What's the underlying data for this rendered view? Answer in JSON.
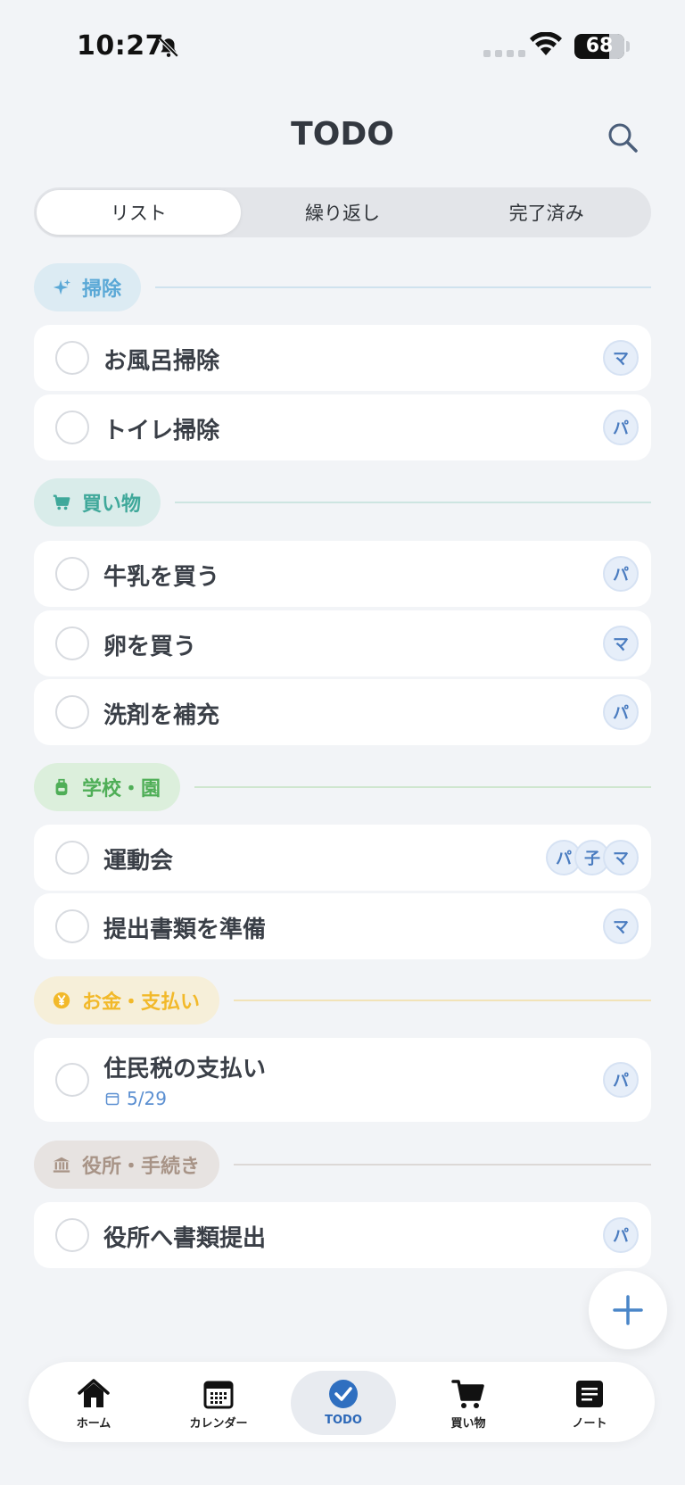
{
  "status_bar": {
    "time": "10:27",
    "battery": "68"
  },
  "header": {
    "title": "TODO"
  },
  "tabs": [
    {
      "label": "リスト",
      "active": true
    },
    {
      "label": "繰り返し",
      "active": false
    },
    {
      "label": "完了済み",
      "active": false
    }
  ],
  "sections": [
    {
      "name": "掃除",
      "icon": "sparkle-icon",
      "color": "#5aa8d6",
      "bg": "#dcebf3",
      "tasks": [
        {
          "title": "お風呂掃除",
          "assignees": [
            "マ"
          ]
        },
        {
          "title": "トイレ掃除",
          "assignees": [
            "パ"
          ]
        }
      ]
    },
    {
      "name": "買い物",
      "icon": "cart-icon",
      "color": "#3fa89a",
      "bg": "#d9ecea",
      "tasks": [
        {
          "title": "牛乳を買う",
          "assignees": [
            "パ"
          ]
        },
        {
          "title": "卵を買う",
          "assignees": [
            "マ"
          ]
        },
        {
          "title": "洗剤を補充",
          "assignees": [
            "パ"
          ]
        }
      ]
    },
    {
      "name": "学校・園",
      "icon": "backpack-icon",
      "color": "#4fae57",
      "bg": "#dcefdc",
      "tasks": [
        {
          "title": "運動会",
          "assignees": [
            "パ",
            "子",
            "マ"
          ]
        },
        {
          "title": "提出書類を準備",
          "assignees": [
            "マ"
          ]
        }
      ]
    },
    {
      "name": "お金・支払い",
      "icon": "yen-icon",
      "color": "#f2b92a",
      "bg": "#f6efd9",
      "tasks": [
        {
          "title": "住民税の支払い",
          "due": "5/29",
          "assignees": [
            "パ"
          ]
        }
      ]
    },
    {
      "name": "役所・手続き",
      "icon": "building-icon",
      "color": "#a89487",
      "bg": "#e7e3e1",
      "tasks": [
        {
          "title": "役所へ書類提出",
          "assignees": [
            "パ"
          ]
        }
      ]
    }
  ],
  "bottom_nav": [
    {
      "label": "ホーム",
      "icon": "home-icon",
      "active": false
    },
    {
      "label": "カレンダー",
      "icon": "calendar-icon",
      "active": false
    },
    {
      "label": "TODO",
      "icon": "check-circle-icon",
      "active": true
    },
    {
      "label": "買い物",
      "icon": "cart-icon",
      "active": false
    },
    {
      "label": "ノート",
      "icon": "note-icon",
      "active": false
    }
  ]
}
